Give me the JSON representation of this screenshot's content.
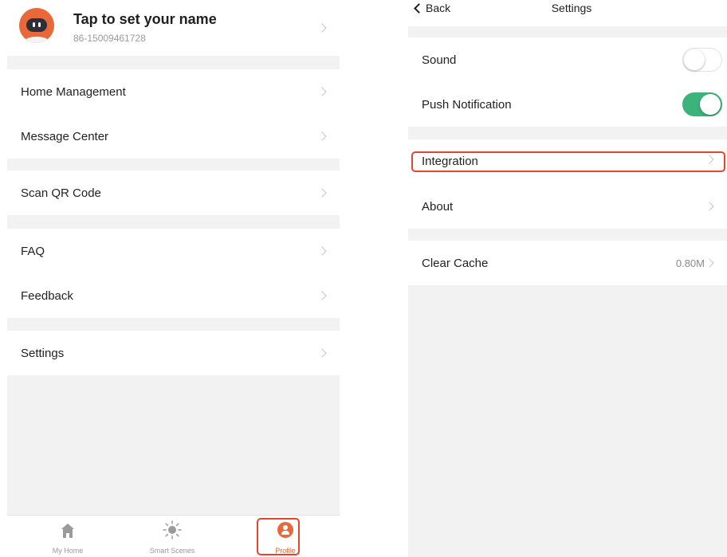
{
  "profile": {
    "name": "Tap to set your name",
    "phone": "86-15009461728"
  },
  "menu": {
    "home_management": "Home Management",
    "message_center": "Message Center",
    "scan_qr": "Scan QR Code",
    "faq": "FAQ",
    "feedback": "Feedback",
    "settings": "Settings"
  },
  "tabbar": {
    "home": "My Home",
    "scenes": "Smart Scenes",
    "profile": "Profile",
    "active": "profile"
  },
  "settings_screen": {
    "back": "Back",
    "title": "Settings",
    "sound": {
      "label": "Sound",
      "on": false
    },
    "push": {
      "label": "Push Notification",
      "on": true
    },
    "integration": "Integration",
    "about": "About",
    "clear_cache": {
      "label": "Clear Cache",
      "value": "0.80M"
    }
  },
  "colors": {
    "accent": "#e8683a",
    "highlight": "#e2462b",
    "toggle_on": "#3cb37a",
    "background": "#f2f2f2"
  }
}
